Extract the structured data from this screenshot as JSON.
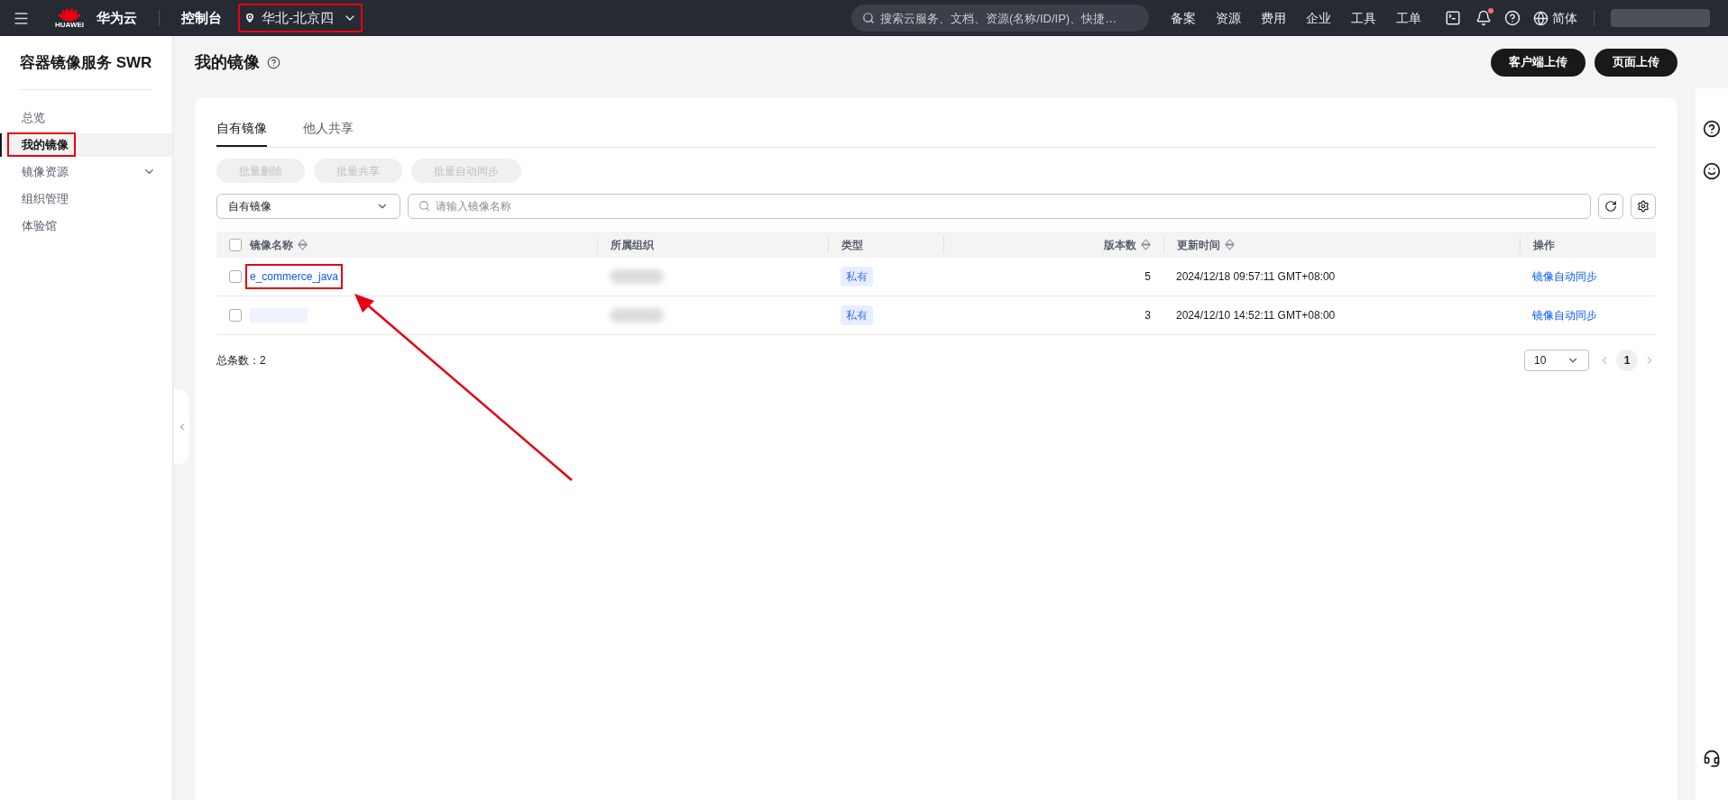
{
  "topbar": {
    "logo_caption": "HUAWEI",
    "brand": "华为云",
    "console": "控制台",
    "region": {
      "label": "华北-北京四",
      "highlighted": true
    },
    "search": {
      "placeholder": "搜索云服务、文档、资源(名称/ID/IP)、快捷…"
    },
    "nav": [
      "备案",
      "资源",
      "费用",
      "企业",
      "工具",
      "工单"
    ],
    "notification_dot": true,
    "language": "简体"
  },
  "sidebar": {
    "title": "容器镜像服务 SWR",
    "items": [
      {
        "label": "总览",
        "selected": false,
        "highlighted": false,
        "expandable": false
      },
      {
        "label": "我的镜像",
        "selected": true,
        "highlighted": true,
        "expandable": false
      },
      {
        "label": "镜像资源",
        "selected": false,
        "highlighted": false,
        "expandable": true
      },
      {
        "label": "组织管理",
        "selected": false,
        "highlighted": false,
        "expandable": false
      },
      {
        "label": "体验馆",
        "selected": false,
        "highlighted": false,
        "expandable": false
      }
    ]
  },
  "page": {
    "title": "我的镜像",
    "actions": [
      "客户端上传",
      "页面上传"
    ]
  },
  "tabs": [
    {
      "label": "自有镜像",
      "selected": true
    },
    {
      "label": "他人共享",
      "selected": false
    }
  ],
  "bulk_actions": [
    {
      "label": "批量删除",
      "disabled": true
    },
    {
      "label": "批量共享",
      "disabled": true
    },
    {
      "label": "批量自动同步",
      "disabled": true
    }
  ],
  "filter": {
    "value": "自有镜像"
  },
  "search": {
    "placeholder": "请输入镜像名称"
  },
  "table": {
    "select_all_checked": false,
    "columns": [
      {
        "label": "镜像名称",
        "sortable": true
      },
      {
        "label": "所属组织",
        "sortable": false
      },
      {
        "label": "类型",
        "sortable": false
      },
      {
        "label": "版本数",
        "sortable": true
      },
      {
        "label": "更新时间",
        "sortable": true
      },
      {
        "label": "操作",
        "sortable": false
      }
    ],
    "rows": [
      {
        "name": "e_commerce_java",
        "checked": false,
        "name_hidden": false,
        "highlighted": true,
        "org_hidden": true,
        "type": "私有",
        "versions": "5",
        "updated": "2024/12/18 09:57:11 GMT+08:00",
        "action": "镜像自动同步"
      },
      {
        "name_hidden": true,
        "checked": false,
        "highlighted": false,
        "org_hidden": true,
        "type": "私有",
        "versions": "3",
        "updated": "2024/12/10 14:52:11 GMT+08:00",
        "action": "镜像自动同步"
      }
    ]
  },
  "footer": {
    "total": "总条数：2",
    "page_size": "10",
    "pages": [
      {
        "label": "1",
        "selected": true
      }
    ]
  }
}
